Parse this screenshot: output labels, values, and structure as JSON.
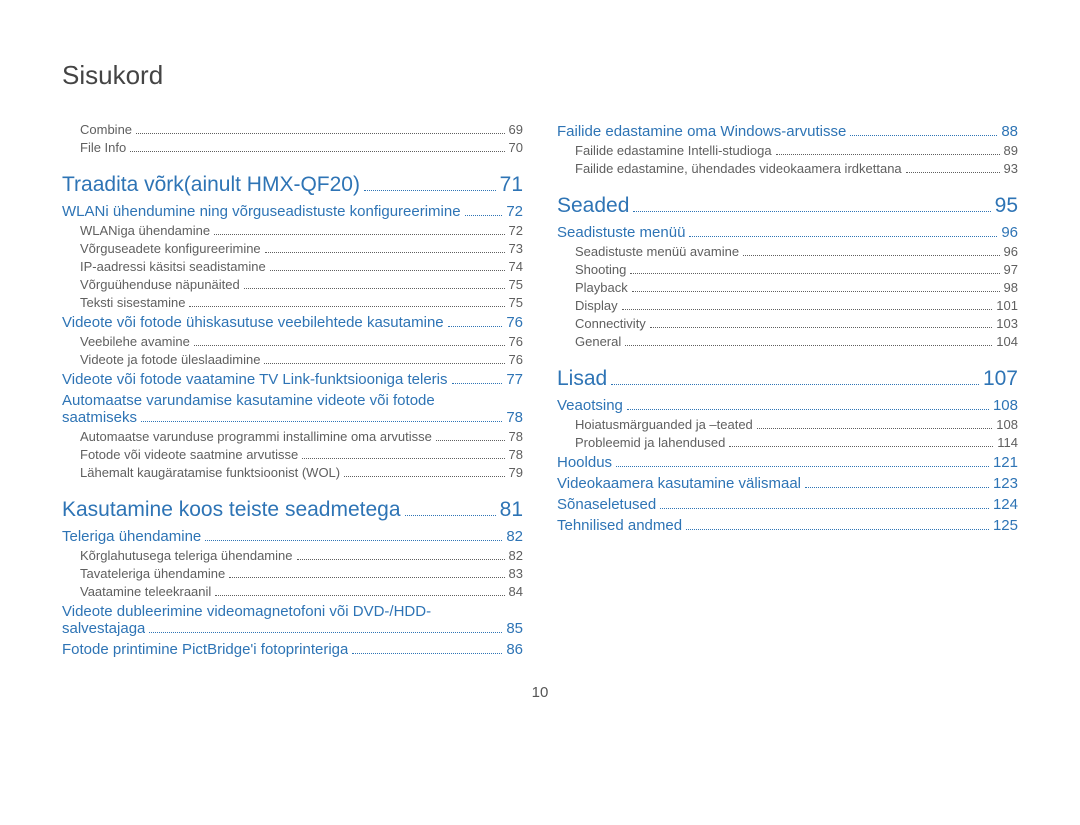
{
  "title": "Sisukord",
  "page_number": "10",
  "left_column": [
    {
      "level": "sub",
      "label": "Combine",
      "page": "69"
    },
    {
      "level": "sub",
      "label": "File Info",
      "page": "70"
    },
    {
      "level": "chapter",
      "label": "Traadita võrk(ainult HMX-QF20)",
      "page": "71"
    },
    {
      "level": "section",
      "label": "WLANi ühendumine ning võrguseadistuste konfigureerimine",
      "page": "72"
    },
    {
      "level": "sub",
      "label": "WLANiga ühendamine",
      "page": "72"
    },
    {
      "level": "sub",
      "label": "Võrguseadete konfigureerimine",
      "page": "73"
    },
    {
      "level": "sub",
      "label": "IP-aadressi käsitsi seadistamine",
      "page": "74"
    },
    {
      "level": "sub",
      "label": "Võrguühenduse näpunäited",
      "page": "75"
    },
    {
      "level": "sub",
      "label": "Teksti sisestamine",
      "page": "75"
    },
    {
      "level": "section",
      "label": "Videote või fotode ühiskasutuse veebilehtede kasutamine",
      "page": "76"
    },
    {
      "level": "sub",
      "label": "Veebilehe avamine",
      "page": "76"
    },
    {
      "level": "sub",
      "label": "Videote ja fotode üleslaadimine",
      "page": "76"
    },
    {
      "level": "section",
      "label": "Videote või fotode vaatamine TV Link-funktsiooniga teleris",
      "page": "77"
    },
    {
      "level": "section_wrap1",
      "label": "Automaatse varundamise kasutamine videote või fotode"
    },
    {
      "level": "section_wrap2",
      "label": "saatmiseks",
      "page": "78"
    },
    {
      "level": "sub",
      "label": "Automaatse varunduse programmi installimine oma arvutisse",
      "page": "78"
    },
    {
      "level": "sub",
      "label": "Fotode või videote saatmine arvutisse",
      "page": "78"
    },
    {
      "level": "sub",
      "label": "Lähemalt kaugäratamise funktsioonist (WOL)",
      "page": "79"
    },
    {
      "level": "chapter",
      "label": "Kasutamine koos teiste seadmetega",
      "page": "81"
    },
    {
      "level": "section",
      "label": "Teleriga ühendamine",
      "page": "82"
    },
    {
      "level": "sub",
      "label": "Kõrglahutusega teleriga ühendamine",
      "page": "82"
    },
    {
      "level": "sub",
      "label": "Tavateleriga ühendamine",
      "page": "83"
    },
    {
      "level": "sub",
      "label": "Vaatamine teleekraanil",
      "page": "84"
    },
    {
      "level": "section_wrap1",
      "label": "Videote dubleerimine videomagnetofoni või DVD-/HDD-"
    },
    {
      "level": "section_wrap2",
      "label": "salvestajaga",
      "page": "85"
    },
    {
      "level": "section",
      "label": "Fotode printimine PictBridge'i fotoprinteriga",
      "page": "86"
    }
  ],
  "right_column": [
    {
      "level": "section",
      "label": "Failide edastamine oma Windows-arvutisse",
      "page": "88"
    },
    {
      "level": "sub",
      "label": "Failide edastamine Intelli-studioga",
      "page": "89"
    },
    {
      "level": "sub",
      "label": "Failide edastamine, ühendades videokaamera irdkettana",
      "page": "93"
    },
    {
      "level": "chapter",
      "label": "Seaded",
      "page": "95"
    },
    {
      "level": "section",
      "label": "Seadistuste menüü",
      "page": "96"
    },
    {
      "level": "sub",
      "label": "Seadistuste menüü avamine",
      "page": "96"
    },
    {
      "level": "sub",
      "label": "Shooting",
      "page": "97"
    },
    {
      "level": "sub",
      "label": "Playback",
      "page": "98"
    },
    {
      "level": "sub",
      "label": "Display",
      "page": "101"
    },
    {
      "level": "sub",
      "label": "Connectivity",
      "page": "103"
    },
    {
      "level": "sub",
      "label": "General",
      "page": "104"
    },
    {
      "level": "chapter",
      "label": "Lisad",
      "page": "107"
    },
    {
      "level": "section",
      "label": "Veaotsing",
      "page": "108"
    },
    {
      "level": "sub",
      "label": "Hoiatusmärguanded ja –teated",
      "page": "108"
    },
    {
      "level": "sub",
      "label": "Probleemid ja lahendused",
      "page": "114"
    },
    {
      "level": "section",
      "label": "Hooldus",
      "page": "121"
    },
    {
      "level": "section",
      "label": "Videokaamera kasutamine välismaal",
      "page": "123"
    },
    {
      "level": "section",
      "label": "Sõnaseletused",
      "page": "124"
    },
    {
      "level": "section",
      "label": "Tehnilised andmed",
      "page": "125"
    }
  ]
}
